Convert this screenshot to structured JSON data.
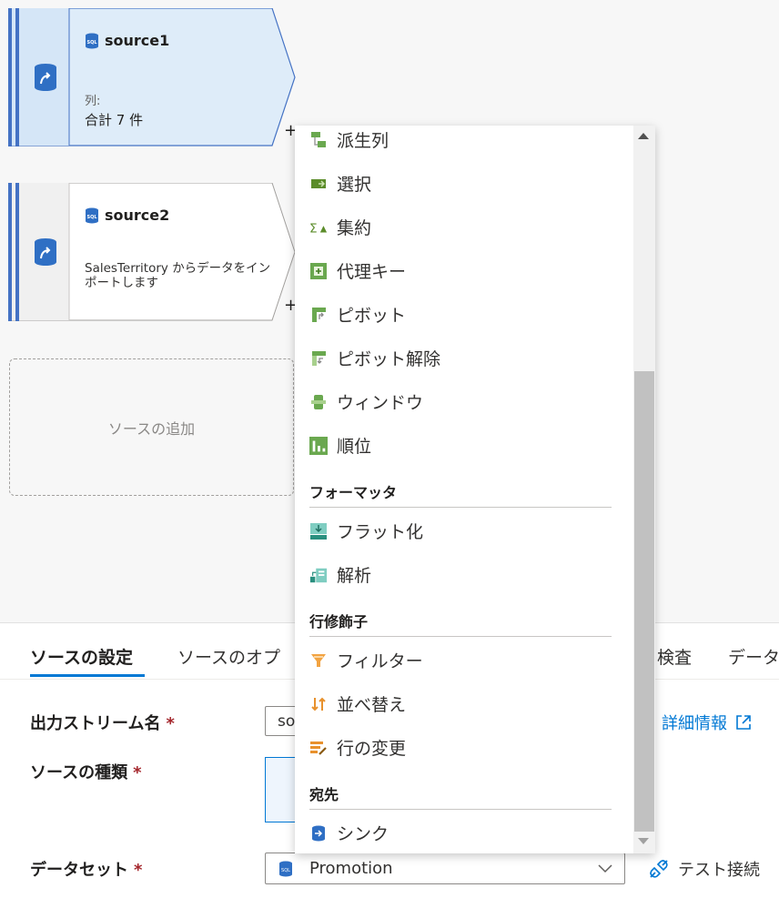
{
  "canvas": {
    "source1": {
      "title": "source1",
      "sub_label": "列:",
      "sub_value": "合計 7 件"
    },
    "source2": {
      "title": "source2",
      "description": "SalesTerritory からデータをインポートします"
    },
    "plus": "+",
    "add_source": "ソースの追加"
  },
  "menu": {
    "items": [
      {
        "label": "派生列",
        "icon": "derived-column-icon"
      },
      {
        "label": "選択",
        "icon": "select-icon"
      },
      {
        "label": "集約",
        "icon": "aggregate-icon"
      },
      {
        "label": "代理キー",
        "icon": "surrogate-key-icon"
      },
      {
        "label": "ピボット",
        "icon": "pivot-icon"
      },
      {
        "label": "ピボット解除",
        "icon": "unpivot-icon"
      },
      {
        "label": "ウィンドウ",
        "icon": "window-icon"
      },
      {
        "label": "順位",
        "icon": "rank-icon"
      }
    ],
    "formatter_header": "フォーマッタ",
    "formatter_items": [
      {
        "label": "フラット化",
        "icon": "flatten-icon"
      },
      {
        "label": "解析",
        "icon": "parse-icon"
      }
    ],
    "row_modifier_header": "行修飾子",
    "row_modifier_items": [
      {
        "label": "フィルター",
        "icon": "filter-icon"
      },
      {
        "label": "並べ替え",
        "icon": "sort-icon"
      },
      {
        "label": "行の変更",
        "icon": "alter-row-icon"
      }
    ],
    "destination_header": "宛先",
    "destination_items": [
      {
        "label": "シンク",
        "icon": "sink-icon"
      }
    ]
  },
  "tabs": [
    {
      "label": "ソースの設定",
      "active": true
    },
    {
      "label": "ソースのオプ"
    },
    {
      "label": "検査"
    },
    {
      "label": "データ"
    }
  ],
  "form": {
    "output_stream_label": "出力ストリーム名",
    "output_stream_value": "so",
    "source_type_label": "ソースの種類",
    "dataset_label": "データセット",
    "dataset_value": "Promotion",
    "details_link": "詳細情報",
    "test_connection": "テスト接続",
    "required_mark": "*"
  },
  "colors": {
    "accent": "#0078d4",
    "node_bar": "#4472c4",
    "node_selected_bg": "#deecf9",
    "required": "#a4262c"
  }
}
